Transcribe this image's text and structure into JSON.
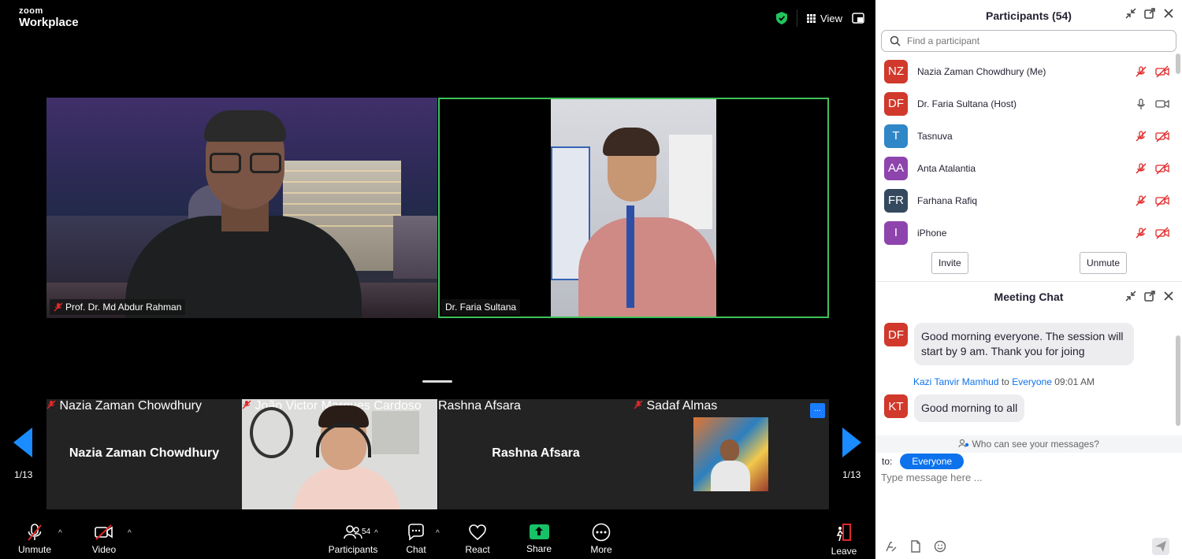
{
  "app": {
    "brand_top": "zoom",
    "brand_main": "Workplace"
  },
  "topbar": {
    "view_label": "View"
  },
  "stage": {
    "left_tile_name": "Prof. Dr. Md Abdur Rahman",
    "right_tile_name": "Dr. Faria Sultana"
  },
  "gallery": {
    "page_left": "1/13",
    "page_right": "1/13",
    "more_label": "...",
    "tiles": [
      {
        "display_name": "Nazia Zaman Chowdhury",
        "tag": "Nazia Zaman Chowdhury"
      },
      {
        "display_name": "",
        "tag": "João Victor Marques Cardoso"
      },
      {
        "display_name": "Rashna Afsara",
        "tag": "Rashna Afsara"
      },
      {
        "display_name": "",
        "tag": "Sadaf Almas"
      }
    ]
  },
  "toolbar": {
    "unmute": "Unmute",
    "video": "Video",
    "participants": "Participants",
    "participants_count": "54",
    "chat": "Chat",
    "react": "React",
    "share": "Share",
    "more": "More",
    "leave": "Leave"
  },
  "participants_panel": {
    "title": "Participants (54)",
    "search_placeholder": "Find a participant",
    "list": [
      {
        "initials": "NZ",
        "name": "Nazia Zaman Chowdhury (Me)",
        "color": "#d0392b",
        "muted": true
      },
      {
        "initials": "DF",
        "name": "Dr. Faria Sultana (Host)",
        "color": "#d0392b",
        "muted": false
      },
      {
        "initials": "T",
        "name": "Tasnuva",
        "color": "#2f87c8",
        "muted": true
      },
      {
        "initials": "AA",
        "name": "Anta Atalantia",
        "color": "#8e44ad",
        "muted": true
      },
      {
        "initials": "FR",
        "name": "Farhana Rafiq",
        "color": "#34495e",
        "muted": true
      },
      {
        "initials": "I",
        "name": "iPhone",
        "color": "#8e44ad",
        "muted": true
      }
    ],
    "invite_label": "Invite",
    "unmute_all_label": "Unmute"
  },
  "chat_panel": {
    "title": "Meeting Chat",
    "messages": [
      {
        "initials": "DF",
        "text_line1": "Good morning everyone. The session will",
        "text_line2": "start by 9 am. Thank you for joing"
      },
      {
        "initials": "KT",
        "sender": "Kazi Tanvir Mamhud",
        "to_word": "to",
        "recipient": "Everyone",
        "time": "09:01 AM",
        "text": "Good morning to all"
      }
    ],
    "who_can_see": "Who can see your messages?",
    "to_label": "to:",
    "to_value": "Everyone",
    "input_placeholder": "Type message here ..."
  }
}
